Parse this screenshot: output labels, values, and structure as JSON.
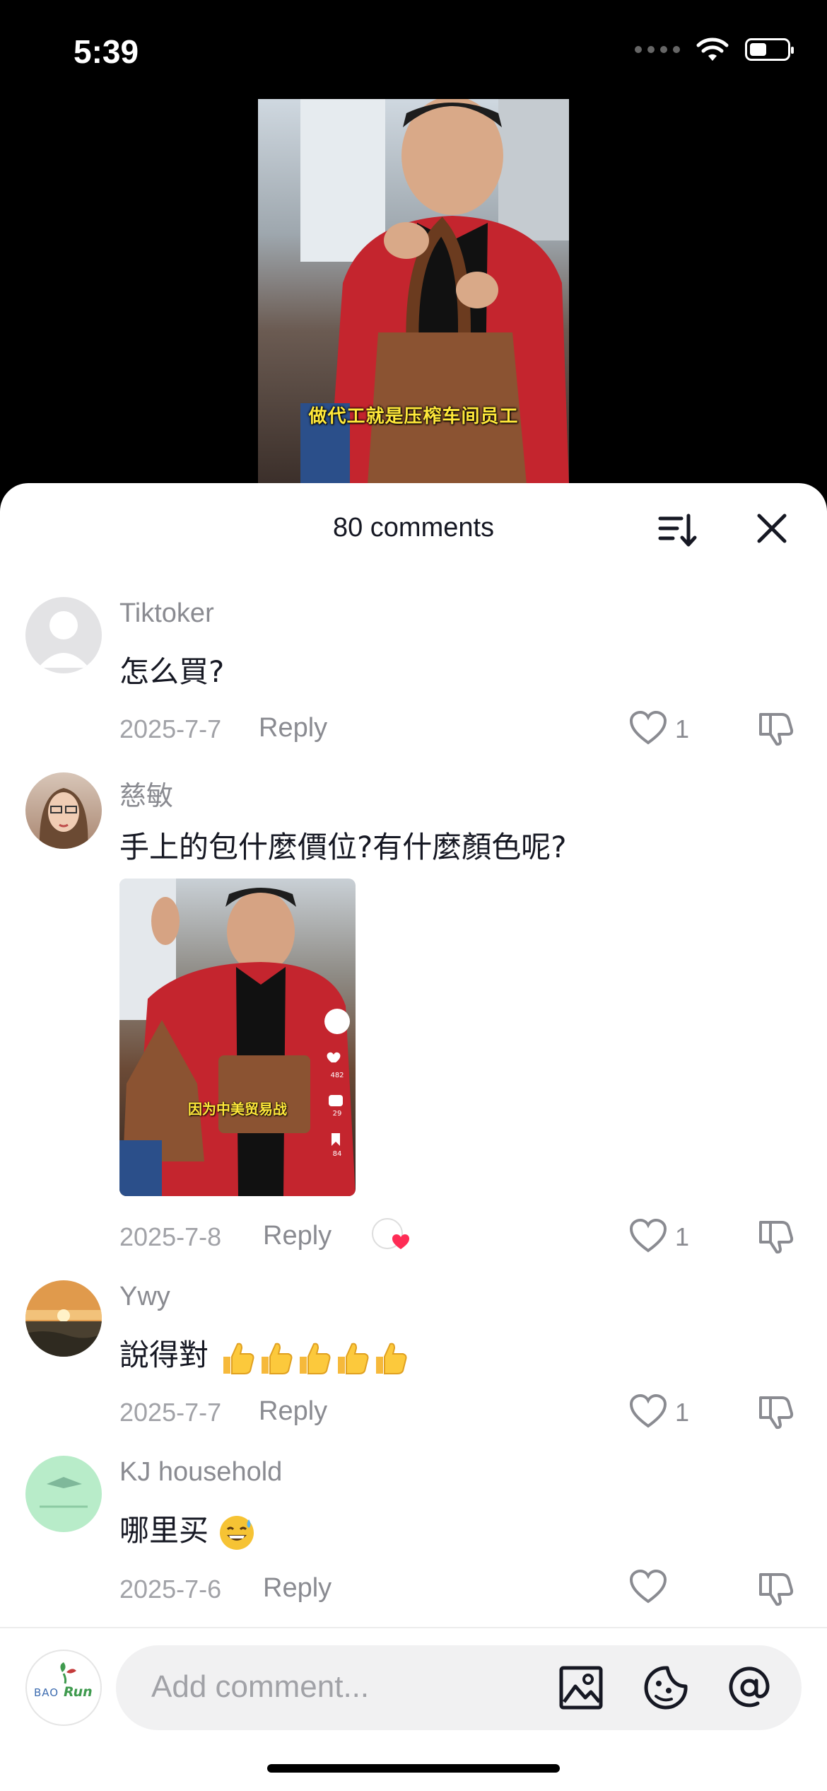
{
  "status_bar": {
    "time": "5:39",
    "battery_level": 0.45
  },
  "video": {
    "caption": "做代工就是压榨车间员工"
  },
  "sheet": {
    "title": "80 comments"
  },
  "comments": [
    {
      "name": "Tiktoker",
      "text": "怎么買?",
      "date": "2025-7-7",
      "reply": "Reply",
      "likes": "1"
    },
    {
      "name": "慈敏",
      "text": "手上的包什麼價位?有什麼顏色呢?",
      "date": "2025-7-8",
      "reply": "Reply",
      "likes": "1",
      "image_caption": "因为中美贸易战",
      "image_likes": "482",
      "image_comments": "29",
      "image_saves": "84"
    },
    {
      "name": "Ywy",
      "text": "說得對",
      "date": "2025-7-7",
      "reply": "Reply",
      "likes": "1"
    },
    {
      "name": "KJ household",
      "text": "哪里买",
      "date": "2025-7-6",
      "reply": "Reply",
      "likes": ""
    }
  ],
  "composer": {
    "placeholder": "Add comment...",
    "avatar_logo": "BAORUN"
  },
  "icons": {
    "sort": "sort-icon",
    "close": "close-icon",
    "like": "heart-outline-icon",
    "dislike": "thumbs-down-icon",
    "image": "image-icon",
    "sticker": "sticker-icon",
    "mention": "at-icon"
  },
  "colors": {
    "accent_red": "#fe2c55",
    "text_primary": "#161823",
    "text_secondary": "#8a8b91"
  }
}
